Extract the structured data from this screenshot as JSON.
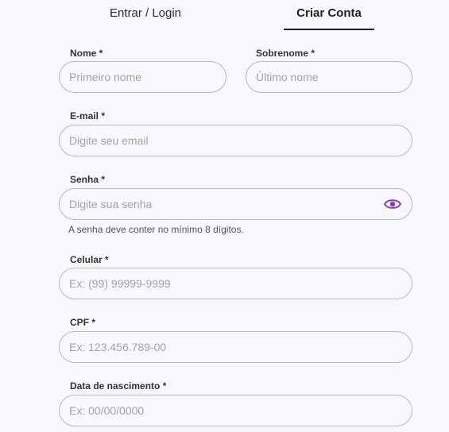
{
  "tabs": {
    "login": "Entrar / Login",
    "signup": "Criar Conta"
  },
  "form": {
    "first_name": {
      "label": "Nome *",
      "placeholder": "Primeiro nome"
    },
    "last_name": {
      "label": "Sobrenome *",
      "placeholder": "Último nome"
    },
    "email": {
      "label": "E-mail *",
      "placeholder": "Digite seu email"
    },
    "password": {
      "label": "Senha *",
      "placeholder": "Digite sua senha",
      "hint": "A senha deve conter no mínimo 8 dígitos."
    },
    "phone": {
      "label": "Celular *",
      "placeholder": "Ex: (99) 99999-9999"
    },
    "cpf": {
      "label": "CPF *",
      "placeholder": "Ex: 123.456.789-00"
    },
    "birthdate": {
      "label": "Data de nascimento *",
      "placeholder": "Ex: 00/00/0000"
    }
  },
  "icons": {
    "password_toggle": "eye-icon"
  },
  "colors": {
    "accent": "#8b3fb8",
    "border": "#b9b9b9",
    "background": "#f7f8fc"
  }
}
